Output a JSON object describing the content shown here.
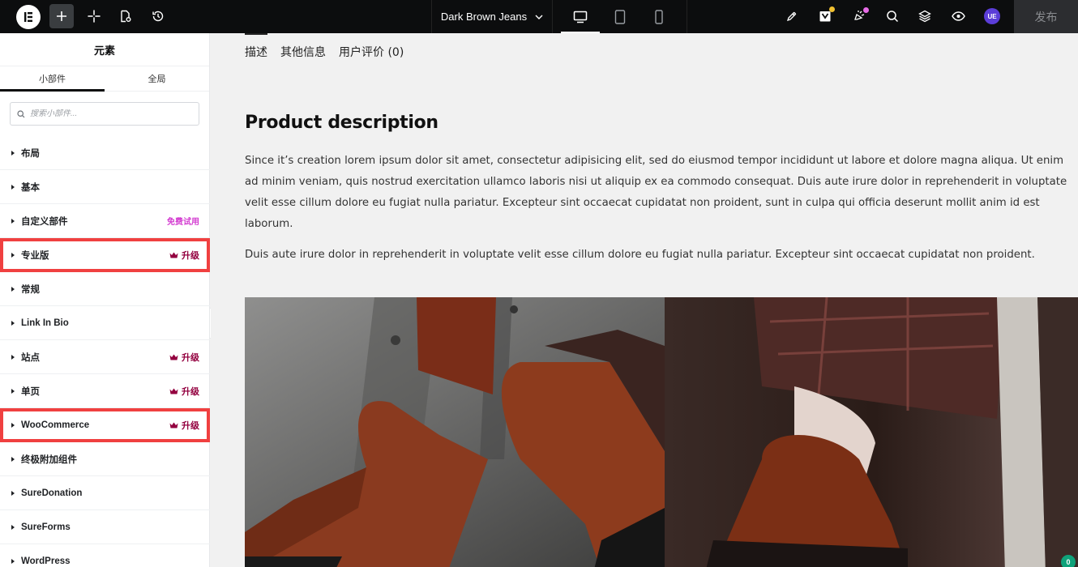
{
  "topbar": {
    "document_title": "Dark Brown Jeans",
    "user_badge": "UE",
    "publish_label": "发布",
    "colors": {
      "background": "#0c0d0e",
      "notify_yellow": "#f0c030",
      "notify_pink": "#e86ce8",
      "user_badge": "#5b3dd8"
    },
    "icons": [
      "elementor-logo-icon",
      "plus-icon",
      "sparkle-icon",
      "page-settings-icon",
      "history-icon",
      "chevron-down-icon",
      "desktop-icon",
      "tablet-icon",
      "mobile-icon",
      "rocket-icon",
      "notes-icon",
      "whats-new-icon",
      "search-icon",
      "structure-icon",
      "preview-eye-icon"
    ]
  },
  "sidebar": {
    "title": "元素",
    "tabs": [
      {
        "label": "小部件"
      },
      {
        "label": "全局"
      }
    ],
    "search_placeholder": "搜索小部件...",
    "categories": [
      {
        "label": "布局"
      },
      {
        "label": "基本"
      },
      {
        "label": "自定义部件",
        "badge": "免费试用"
      },
      {
        "label": "专业版",
        "upgrade": "升级"
      },
      {
        "label": "常规"
      },
      {
        "label": "Link In Bio"
      },
      {
        "label": "站点",
        "upgrade": "升级"
      },
      {
        "label": "单页",
        "upgrade": "升级"
      },
      {
        "label": "WooCommerce",
        "upgrade": "升级"
      },
      {
        "label": "终极附加组件"
      },
      {
        "label": "SureDonation"
      },
      {
        "label": "SureForms"
      },
      {
        "label": "WordPress"
      }
    ],
    "colors": {
      "upgrade": "#93003f",
      "trial": "#d33bd0",
      "highlight_border": "#f04040"
    }
  },
  "canvas": {
    "product_tabs": [
      {
        "label": "描述"
      },
      {
        "label": "其他信息"
      },
      {
        "label": "用户评价 (0)"
      }
    ],
    "heading": "Product description",
    "paragraph1": "Since it’s creation lorem ipsum dolor sit amet, consectetur adipisicing elit, sed do eiusmod tempor incididunt ut labore et dolore magna aliqua. Ut enim ad minim veniam, quis nostrud exercitation ullamco laboris nisi ut aliquip ex ea commodo consequat. Duis aute irure dolor in reprehenderit in voluptate velit esse cillum dolore eu fugiat nulla pariatur. Excepteur sint occaecat cupidatat non proident, sunt in culpa qui officia deserunt mollit anim id est laborum.",
    "paragraph2": "Duis aute irure dolor in reprehenderit in voluptate velit esse cillum dolore eu fugiat nulla pariatur. Excepteur sint occaecat cupidatat non proident.",
    "notification_count": "0"
  }
}
